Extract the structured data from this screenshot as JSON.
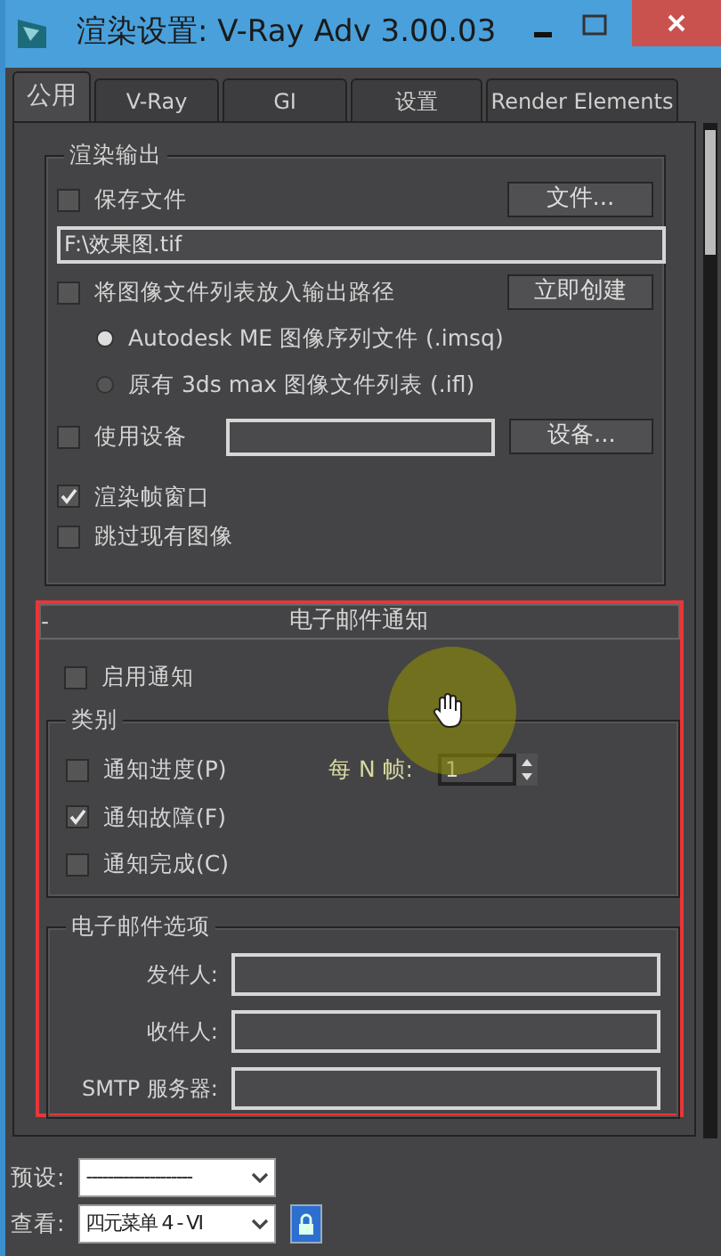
{
  "window": {
    "title": "渲染设置: V-Ray Adv 3.00.03"
  },
  "tabs": [
    {
      "label": "公用",
      "selected": true
    },
    {
      "label": "V-Ray",
      "selected": false
    },
    {
      "label": "GI",
      "selected": false
    },
    {
      "label": "设置",
      "selected": false
    },
    {
      "label": "Render Elements",
      "selected": false
    }
  ],
  "render_output": {
    "title": "渲染输出",
    "save_file": {
      "label": "保存文件",
      "checked": false
    },
    "file_button": "文件...",
    "path": "F:\\效果图.tif",
    "file_list": {
      "label": "将图像文件列表放入输出路径",
      "checked": false
    },
    "create_button": "立即创建",
    "radios": [
      {
        "label": "Autodesk ME 图像序列文件 (.imsq)",
        "selected": true
      },
      {
        "label": "原有 3ds max 图像文件列表 (.ifl)",
        "selected": false
      }
    ],
    "use_device": {
      "label": "使用设备",
      "checked": false
    },
    "device_button": "设备...",
    "options": [
      {
        "label": "渲染帧窗口",
        "checked": true
      },
      {
        "label": "跳过现有图像",
        "checked": false
      }
    ]
  },
  "email_rollout": {
    "collapse_sign": "-",
    "title": "电子邮件通知",
    "enable": {
      "label": "启用通知",
      "checked": false
    },
    "category": {
      "title": "类别",
      "items": [
        {
          "label": "通知进度(P)",
          "checked": false
        },
        {
          "label": "通知故障(F)",
          "checked": true
        },
        {
          "label": "通知完成(C)",
          "checked": false
        }
      ],
      "every_n_label": "每 N 帧:",
      "every_n_value": "1"
    },
    "options": {
      "title": "电子邮件选项",
      "fields": [
        {
          "label": "发件人:"
        },
        {
          "label": "收件人:"
        },
        {
          "label": "SMTP 服务器:"
        }
      ]
    }
  },
  "bottom": {
    "preset": {
      "label": "预设:",
      "value": "--------------------"
    },
    "view": {
      "label": "查看:",
      "value": "四元菜单 4 - VI"
    }
  }
}
